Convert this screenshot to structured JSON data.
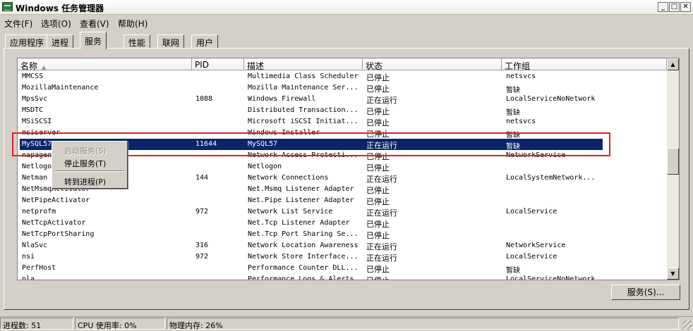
{
  "window": {
    "title": "Windows 任务管理器",
    "controls": {
      "minimize": "_",
      "maximize": "□",
      "close": "✕"
    }
  },
  "menu": [
    "文件(F)",
    "选项(O)",
    "查看(V)",
    "帮助(H)"
  ],
  "tabs": [
    {
      "label": "应用程序",
      "active": false
    },
    {
      "label": "进程",
      "active": false
    },
    {
      "label": "服务",
      "active": true
    },
    {
      "label": "性能",
      "active": false
    },
    {
      "label": "联网",
      "active": false
    },
    {
      "label": "用户",
      "active": false
    }
  ],
  "columns": [
    "名称",
    "PID",
    "描述",
    "状态",
    "工作组"
  ],
  "sort_indicator": "▲",
  "rows": [
    {
      "name": "MMCSS",
      "pid": "",
      "desc": "Multimedia Class Scheduler",
      "status": "已停止",
      "group": "netsvcs"
    },
    {
      "name": "MozillaMaintenance",
      "pid": "",
      "desc": "Mozilla Maintenance Ser...",
      "status": "已停止",
      "group": "暂缺"
    },
    {
      "name": "MpsSvc",
      "pid": "1088",
      "desc": "Windows Firewall",
      "status": "正在运行",
      "group": "LocalServiceNoNetwork"
    },
    {
      "name": "MSDTC",
      "pid": "",
      "desc": "Distributed Transaction...",
      "status": "已停止",
      "group": "暂缺"
    },
    {
      "name": "MSiSCSI",
      "pid": "",
      "desc": "Microsoft iSCSI Initiat...",
      "status": "已停止",
      "group": "netsvcs"
    },
    {
      "name": "msiserver",
      "pid": "",
      "desc": "Windows Installer",
      "status": "已停止",
      "group": "暂缺"
    },
    {
      "name": "MySQL57",
      "pid": "11644",
      "desc": "MySQL57",
      "status": "正在运行",
      "group": "暂缺",
      "selected": true
    },
    {
      "name": "napagent",
      "pid": "",
      "desc": "Network Access Protecti...",
      "status": "已停止",
      "group": "NetworkService"
    },
    {
      "name": "Netlogon",
      "pid": "",
      "desc": "Netlogon",
      "status": "已停止",
      "group": ""
    },
    {
      "name": "Netman",
      "pid": "144",
      "desc": "Network Connections",
      "status": "正在运行",
      "group": "LocalSystemNetwork..."
    },
    {
      "name": "NetMsmqActivator",
      "pid": "",
      "desc": "Net.Msmq Listener Adapter",
      "status": "已停止",
      "group": ""
    },
    {
      "name": "NetPipeActivator",
      "pid": "",
      "desc": "Net.Pipe Listener Adapter",
      "status": "已停止",
      "group": ""
    },
    {
      "name": "netprofm",
      "pid": "972",
      "desc": "Network List Service",
      "status": "正在运行",
      "group": "LocalService"
    },
    {
      "name": "NetTcpActivator",
      "pid": "",
      "desc": "Net.Tcp Listener Adapter",
      "status": "已停止",
      "group": ""
    },
    {
      "name": "NetTcpPortSharing",
      "pid": "",
      "desc": "Net.Tcp Port Sharing Se...",
      "status": "已停止",
      "group": ""
    },
    {
      "name": "NlaSvc",
      "pid": "316",
      "desc": "Network Location Awareness",
      "status": "正在运行",
      "group": "NetworkService"
    },
    {
      "name": "nsi",
      "pid": "972",
      "desc": "Network Store Interface...",
      "status": "正在运行",
      "group": "LocalService"
    },
    {
      "name": "PerfHost",
      "pid": "",
      "desc": "Performance Counter DLL...",
      "status": "已停止",
      "group": "暂缺"
    },
    {
      "name": "pla",
      "pid": "",
      "desc": "Performance Logs & Alerts",
      "status": "已停止",
      "group": "LocalServiceNoNetwork"
    }
  ],
  "context_menu": [
    {
      "label": "启动服务(S)",
      "disabled": true
    },
    {
      "label": "停止服务(T)",
      "disabled": false
    },
    {
      "label": "转到进程(P)",
      "disabled": false
    }
  ],
  "services_button": "服务(S)...",
  "status": {
    "processes": "进程数: 51",
    "cpu": "CPU 使用率: 0%",
    "memory": "物理内存: 26%"
  },
  "colors": {
    "selection": "#0a246a",
    "highlight_box": "#e02020",
    "chrome": "#d4d0c8"
  }
}
